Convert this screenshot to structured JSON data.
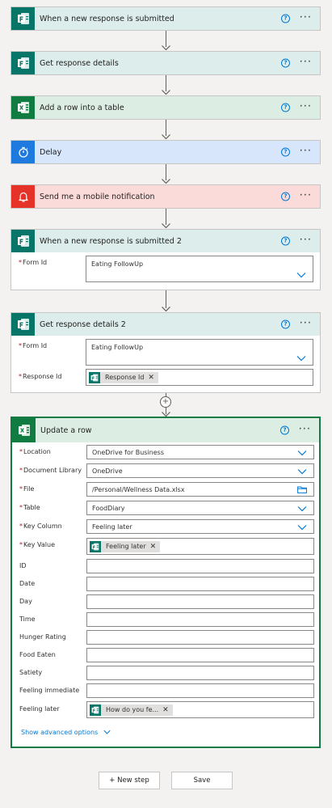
{
  "steps": [
    {
      "title": "When a new response is submitted",
      "type": "forms"
    },
    {
      "title": "Get response details",
      "type": "forms"
    },
    {
      "title": "Add a row into a table",
      "type": "excel"
    },
    {
      "title": "Delay",
      "type": "delay"
    },
    {
      "title": "Send me a mobile notification",
      "type": "notification"
    }
  ],
  "step6": {
    "title": "When a new response is submitted 2",
    "fields": [
      {
        "label": "Form Id",
        "required": true,
        "value": "Eating FollowUp"
      }
    ]
  },
  "step7": {
    "title": "Get response details 2",
    "fields": [
      {
        "label": "Form Id",
        "required": true,
        "value": "Eating FollowUp"
      },
      {
        "label": "Response Id",
        "required": true,
        "token": "Response Id"
      }
    ]
  },
  "step8": {
    "title": "Update a row",
    "fields": [
      {
        "label": "Location",
        "required": true,
        "value": "OneDrive for Business"
      },
      {
        "label": "Document Library",
        "required": true,
        "value": "OneDrive"
      },
      {
        "label": "File",
        "required": true,
        "value": "/Personal/Wellness Data.xlsx"
      },
      {
        "label": "Table",
        "required": true,
        "value": "FoodDiary"
      },
      {
        "label": "Key Column",
        "required": true,
        "value": "Feeling later"
      },
      {
        "label": "Key Value",
        "required": true,
        "token": "Feeling later"
      },
      {
        "label": "ID",
        "required": false,
        "value": ""
      },
      {
        "label": "Date",
        "required": false,
        "value": ""
      },
      {
        "label": "Day",
        "required": false,
        "value": ""
      },
      {
        "label": "Time",
        "required": false,
        "value": ""
      },
      {
        "label": "Hunger Rating",
        "required": false,
        "value": ""
      },
      {
        "label": "Food Eaten",
        "required": false,
        "value": ""
      },
      {
        "label": "Satiety",
        "required": false,
        "value": ""
      },
      {
        "label": "Feeling immediate",
        "required": false,
        "value": ""
      },
      {
        "label": "Feeling later",
        "required": false,
        "token": "How do you fe..."
      }
    ],
    "advanced_link": "Show advanced options"
  },
  "help_glyph": "?",
  "more_glyph": "···",
  "required_mark": "*",
  "remove_glyph": "✕",
  "add_glyph": "+",
  "buttons": {
    "new_step": "+ New step",
    "save": "Save"
  },
  "colors": {
    "forms": "#077568",
    "excel": "#107c41",
    "delay": "#1f7ae0",
    "notification": "#e6332a",
    "link": "#0078d4",
    "required": "#a4262c"
  }
}
